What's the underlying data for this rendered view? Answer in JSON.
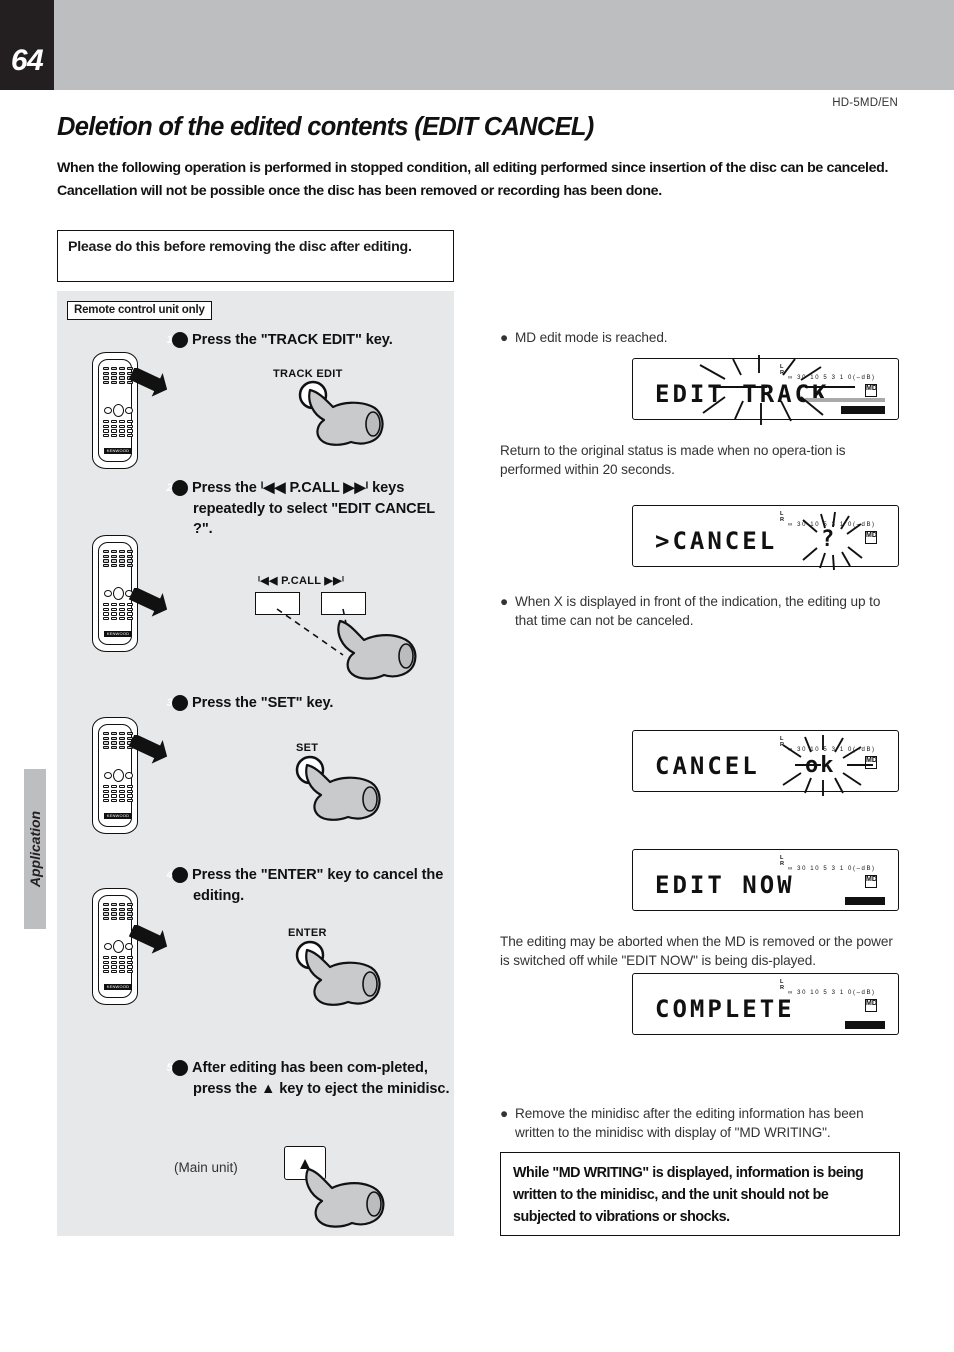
{
  "page": {
    "number": "64",
    "model_code": "HD-5MD/EN",
    "side_tab": "Application",
    "title": "Deletion of the edited contents (EDIT CANCEL)",
    "intro": "When the following operation is performed in stopped condition, all editing performed since insertion of the disc can be canceled. Cancellation will not be possible once the disc has been removed or recording has been done.",
    "notice": "Please do this before removing the disc after editing."
  },
  "steps_panel": {
    "remote_only_tag": "Remote control unit only",
    "main_unit_label": "(Main unit)",
    "steps": [
      {
        "num": "1",
        "text": "Press the \"TRACK EDIT\" key.",
        "key_label": "TRACK EDIT"
      },
      {
        "num": "2",
        "text": "Press the ᴵ◀◀ P.CALL ▶▶ᴵ keys repeatedly to select \"EDIT CANCEL ?\".",
        "key_label": "ᴵ◀◀  P.CALL  ▶▶ᴵ"
      },
      {
        "num": "3",
        "text": "Press the \"SET\" key.",
        "key_label": "SET"
      },
      {
        "num": "4",
        "text": "Press the \"ENTER\" key to cancel the editing.",
        "key_label": "ENTER"
      },
      {
        "num": "5",
        "text": "After editing has been com-pleted, press the ▲ key to eject the minidisc.",
        "key_label": "▲"
      }
    ]
  },
  "right_column": {
    "note_1": "MD edit mode is reached.",
    "note_2": "Return to the original status is made when no opera-tion is performed within 20 seconds.",
    "note_3": "When X is displayed in front of the indication, the editing up to that time can not be canceled.",
    "note_4": "The editing may be aborted when the MD is removed or the power is switched off while \"EDIT NOW\" is being dis-played.",
    "note_5": "Remove the minidisc after the editing information has been written to the minidisc with display of \"MD WRITING\".",
    "warning": "While \"MD WRITING\" is displayed, information is being written to the minidisc, and the unit should not be subjected to vibrations or shocks.",
    "displays": [
      {
        "text": "EDIT TRACK",
        "blinking": "true",
        "meter_scale": "∞ 30 10  5   3   1   0(–dB)",
        "lr": "L\nR",
        "md_icon": "MD"
      },
      {
        "text": ">CANCEL",
        "blinking": "false",
        "blink_glyph": "?",
        "meter_scale": "∞ 30 10  5   3   1   0(–dB)",
        "lr": "L\nR",
        "md_icon": "MD"
      },
      {
        "text": "CANCEL",
        "blinking": "false",
        "blink_glyph": "ok",
        "meter_scale": "∞ 30 10  5   3   1   0(–dB)",
        "lr": "L\nR",
        "md_icon": "MD"
      },
      {
        "text": "EDIT NOW",
        "blinking": "false",
        "meter_scale": "∞ 30 10  5   3   1   0(–dB)",
        "lr": "L\nR",
        "md_icon": "MD"
      },
      {
        "text": "COMPLETE",
        "blinking": "false",
        "meter_scale": "∞ 30 10  5   3   1   0(–dB)",
        "lr": "L\nR",
        "md_icon": "MD"
      }
    ]
  },
  "colors": {
    "header_gray": "#bcbec0",
    "panel_gray": "#e7e8ea",
    "ink": "#231f20"
  }
}
